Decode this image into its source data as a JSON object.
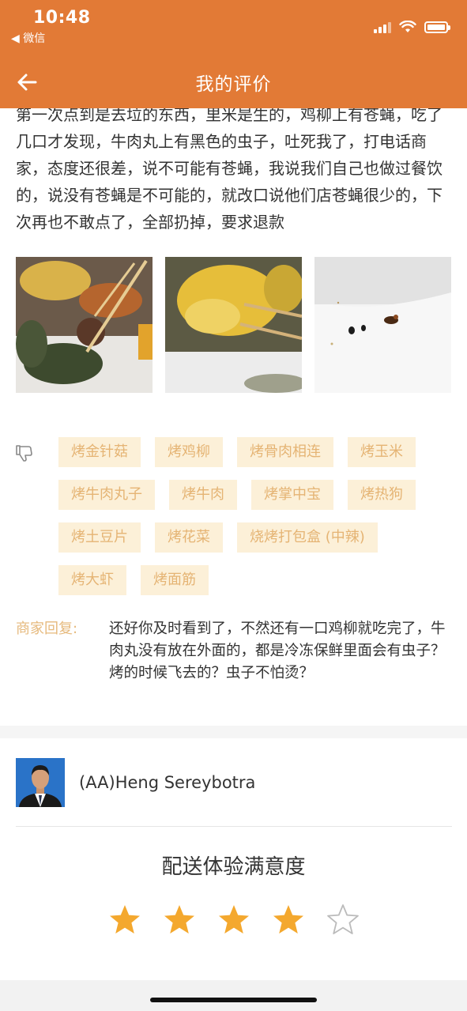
{
  "status_bar": {
    "time": "10:48",
    "back_app": "◀ 微信"
  },
  "nav": {
    "title": "我的评价",
    "back_icon": "arrow-left-icon"
  },
  "review": {
    "text": "第一次点到是去垃的东西，里米是生的，鸡柳上有苍蝇，吃了几口才发现，牛肉丸上有黑色的虫子，吐死我了，打电话商家，态度还很差，说不可能有苍蝇，我说我们自己也做过餐饮的，说没有苍蝇是不可能的，就改口说他们店苍蝇很少的，下次再也不敢点了，全部扔掉，要求退款",
    "photos": [
      "bbq-food-photo",
      "corn-skewer-photo",
      "insects-photo"
    ]
  },
  "disliked_items": {
    "icon": "thumbs-down-icon",
    "tags": [
      "烤金针菇",
      "烤鸡柳",
      "烤骨肉相连",
      "烤玉米",
      "烤牛肉丸子",
      "烤牛肉",
      "烤掌中宝",
      "烤热狗",
      "烤土豆片",
      "烤花菜",
      "烧烤打包盒 (中辣)",
      "烤大虾",
      "烤面筋"
    ]
  },
  "merchant_reply": {
    "label": "商家回复:",
    "text": "还好你及时看到了，不然还有一口鸡柳就吃完了，牛肉丸没有放在外面的，都是冷冻保鲜里面会有虫子？烤的时候飞去的？虫子不怕烫？"
  },
  "courier": {
    "name": "(AA)Heng Sereybotra",
    "rating_title": "配送体验满意度",
    "rating": 4,
    "rating_max": 5
  },
  "colors": {
    "header": "#e27a36",
    "tag_bg": "#fcf0d8",
    "tag_text": "#e5b474",
    "star": "#f4a82e"
  }
}
